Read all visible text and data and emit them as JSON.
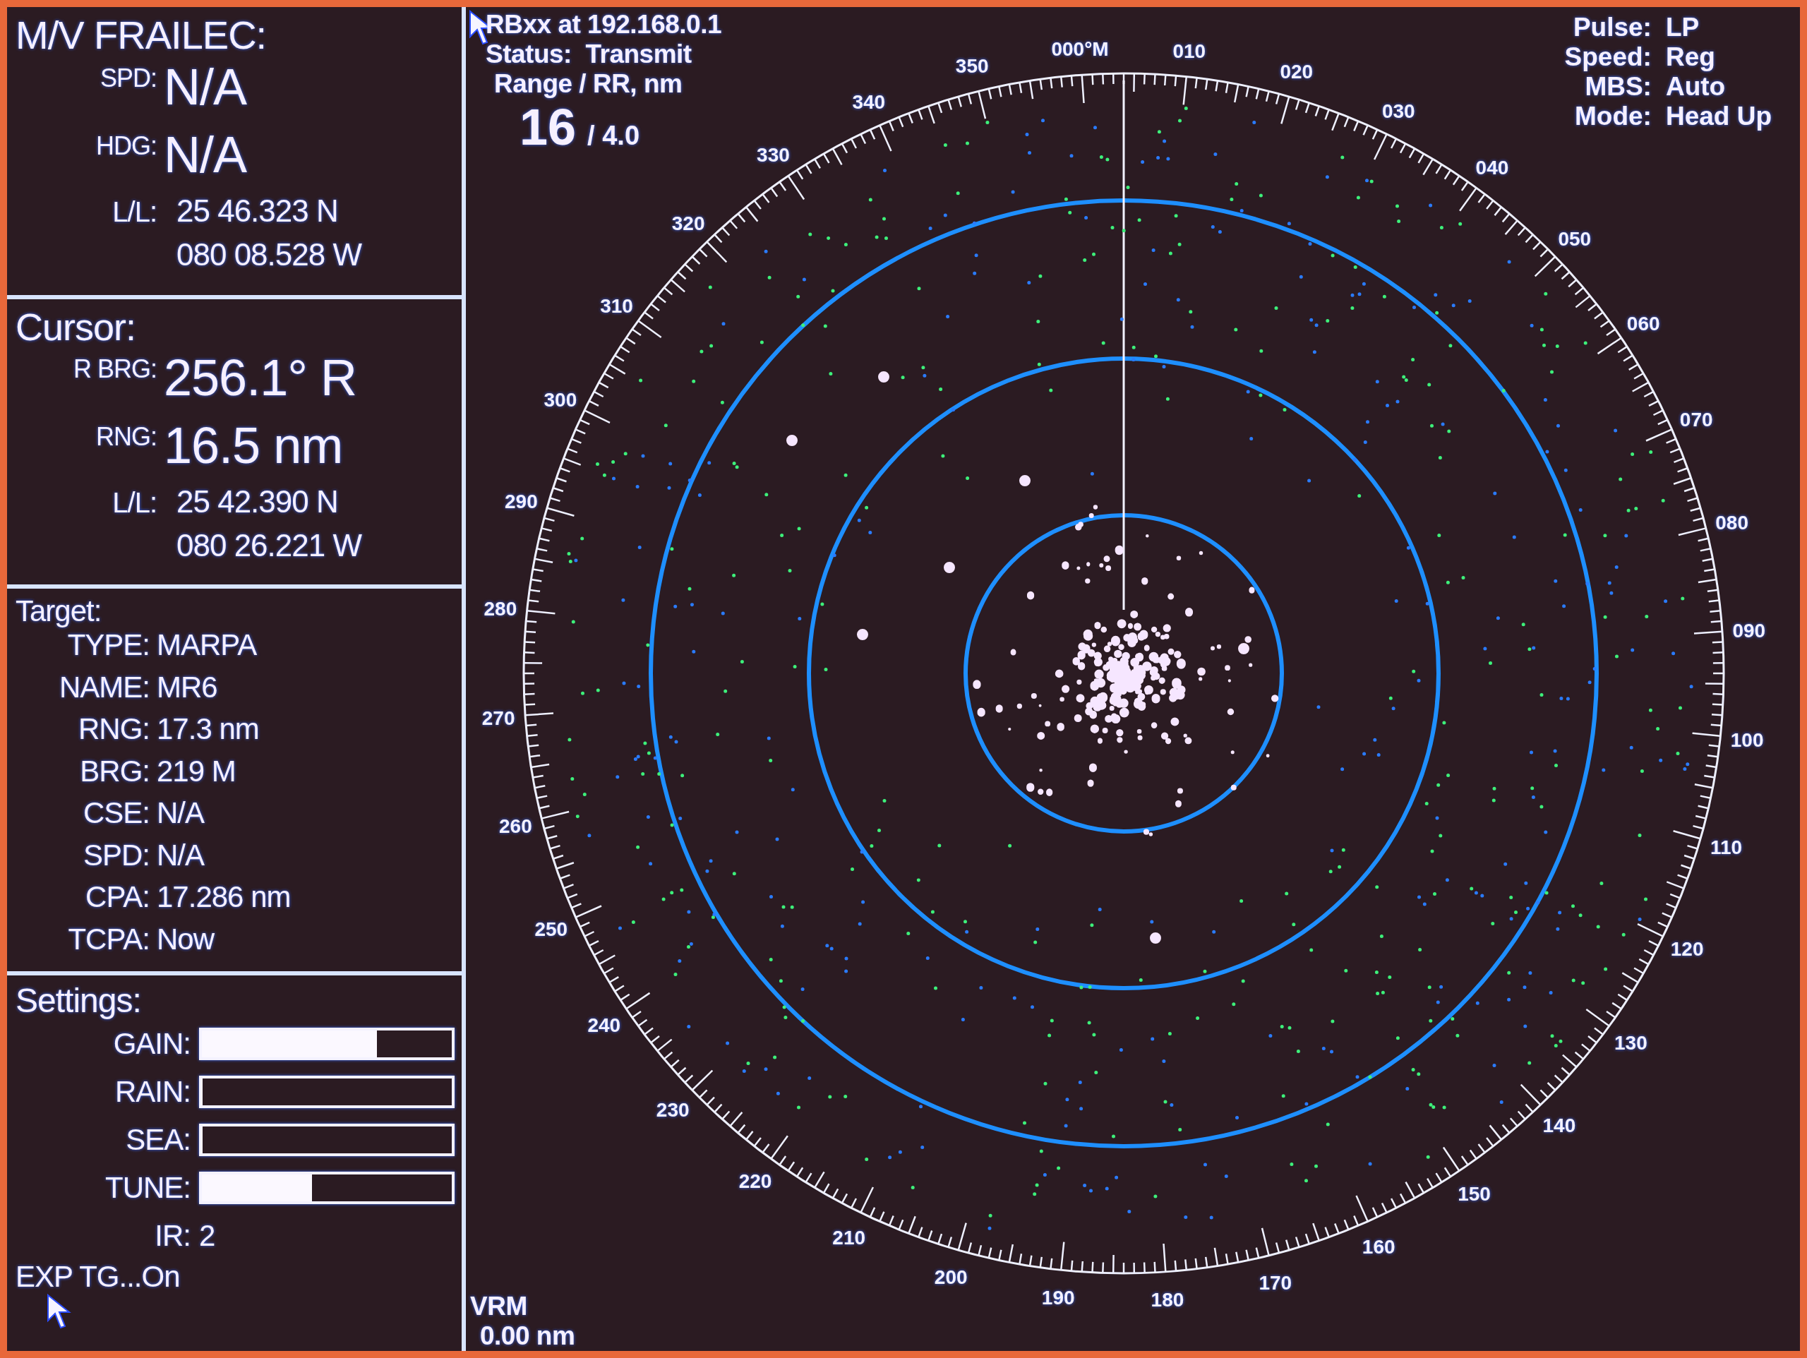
{
  "vessel": {
    "title": "M/V FRAILEC:",
    "rows": [
      {
        "kind": "large",
        "label": "SPD:",
        "value": "N/A"
      },
      {
        "kind": "large",
        "label": "HDG:",
        "value": "N/A"
      },
      {
        "kind": "position",
        "label": "L/L:",
        "value": "25 46.323 N"
      },
      {
        "kind": "position",
        "value": "080 08.528 W"
      }
    ]
  },
  "cursor": {
    "title": "Cursor:",
    "rows": [
      {
        "kind": "large",
        "label": "R BRG:",
        "value": "256.1° R"
      },
      {
        "kind": "large",
        "label": "RNG:",
        "value": "16.5 nm"
      },
      {
        "kind": "position",
        "label": "L/L:",
        "value": "25 42.390 N"
      },
      {
        "kind": "position",
        "value": "080 26.221 W"
      }
    ]
  },
  "target": {
    "title": "Target:",
    "rows": [
      {
        "label": "TYPE:",
        "value": "MARPA"
      },
      {
        "label": "NAME:",
        "value": "MR6"
      },
      {
        "label": "RNG:",
        "value": "17.3 nm"
      },
      {
        "label": "BRG:",
        "value": "219 M"
      },
      {
        "label": "CSE:",
        "value": "N/A"
      },
      {
        "label": "SPD:",
        "value": "N/A"
      },
      {
        "label": "CPA:",
        "value": "17.286 nm"
      },
      {
        "label": "TCPA:",
        "value": "Now"
      }
    ]
  },
  "settings": {
    "title": "Settings:",
    "bars": [
      {
        "label": "GAIN:",
        "level": 0.7
      },
      {
        "label": "RAIN:",
        "level": 0
      },
      {
        "label": "SEA:",
        "level": 0
      },
      {
        "label": "TUNE:",
        "level": 0.44
      }
    ],
    "ir": {
      "label": "IR:",
      "value": "2"
    },
    "exp_target": "EXP TG...On"
  },
  "radar": {
    "source": "RBxx at 192.168.0.1",
    "status": "Status:  Transmit",
    "range_label": "Range / RR, nm",
    "range": "16",
    "ring_spacing": "/ 4.0",
    "modes": [
      {
        "label": "Pulse:",
        "value": "LP"
      },
      {
        "label": "Speed:",
        "value": "Reg"
      },
      {
        "label": "MBS:",
        "value": "Auto"
      },
      {
        "label": "Mode:",
        "value": "Head Up"
      }
    ],
    "vrm_label": "VRM",
    "vrm": "0.00 nm",
    "bearing_labels": [
      "000°M",
      "010",
      "020",
      "030",
      "040",
      "050",
      "060",
      "070",
      "080",
      "090",
      "100",
      "110",
      "120",
      "130",
      "140",
      "150",
      "160",
      "170",
      "180",
      "190",
      "200",
      "210",
      "220",
      "230",
      "240",
      "250",
      "260",
      "270",
      "280",
      "290",
      "300",
      "310",
      "320",
      "330",
      "340",
      "350"
    ]
  }
}
